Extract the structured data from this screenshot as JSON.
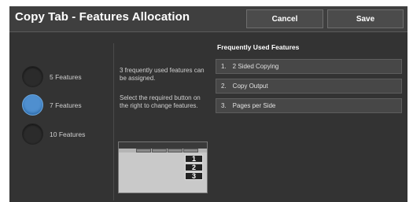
{
  "header": {
    "title": "Copy Tab - Features Allocation",
    "cancel_label": "Cancel",
    "save_label": "Save"
  },
  "options": [
    {
      "label": "5 Features",
      "selected": false
    },
    {
      "label": "7 Features",
      "selected": true
    },
    {
      "label": "10 Features",
      "selected": false
    }
  ],
  "description": {
    "line1": "3 frequently used features can be assigned.",
    "line2": "Select the required button on the right to change features."
  },
  "frequently_used": {
    "title": "Frequently Used Features",
    "items": [
      {
        "num": "1.",
        "label": "2 Sided Copying"
      },
      {
        "num": "2.",
        "label": "Copy Output"
      },
      {
        "num": "3.",
        "label": "Pages per Side"
      }
    ]
  },
  "diagram": {
    "numbers": [
      "1",
      "2",
      "3"
    ]
  },
  "colors": {
    "selected_radio": "#4f8fcf",
    "background": "#333333"
  }
}
